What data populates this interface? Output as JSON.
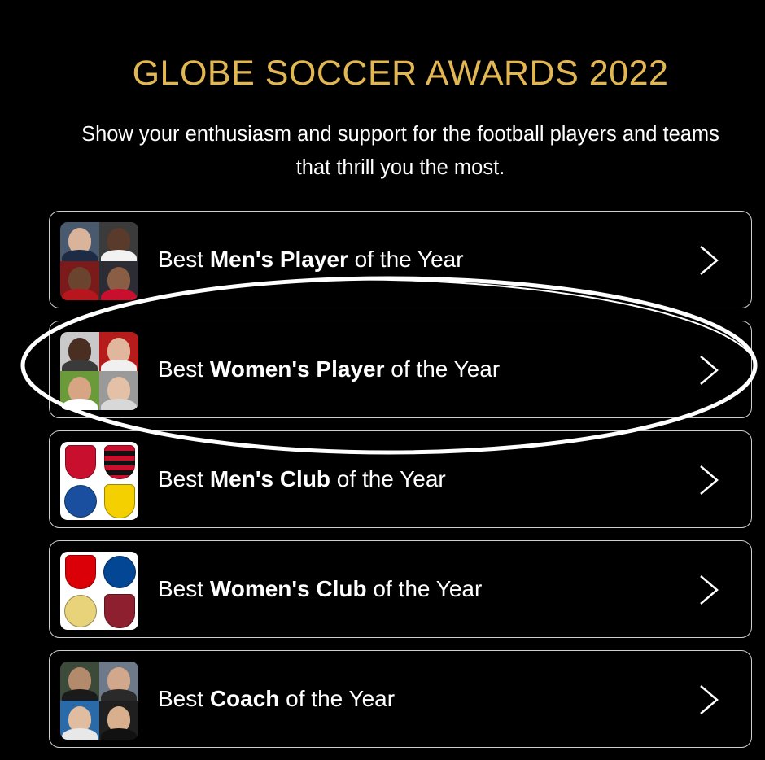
{
  "header": {
    "title": "GLOBE SOCCER AWARDS 2022",
    "subtitle_line1": "Show your enthusiasm and support for the football players and teams",
    "subtitle_line2": "that thrill you the most."
  },
  "categories": [
    {
      "prefix": "Best ",
      "bold": "Men's Player",
      "suffix": " of the Year"
    },
    {
      "prefix": "Best ",
      "bold": "Women's Player",
      "suffix": " of the Year"
    },
    {
      "prefix": "Best ",
      "bold": "Men's Club",
      "suffix": " of the Year"
    },
    {
      "prefix": "Best ",
      "bold": "Women's Club",
      "suffix": " of the Year"
    },
    {
      "prefix": "Best ",
      "bold": "Coach",
      "suffix": " of the Year"
    }
  ],
  "colors": {
    "accent": "#e2b752",
    "background": "#000000",
    "border": "#cfcfcf"
  },
  "icons": {
    "chevron": "chevron-right-icon",
    "highlight": "hand-drawn-oval-annotation"
  }
}
